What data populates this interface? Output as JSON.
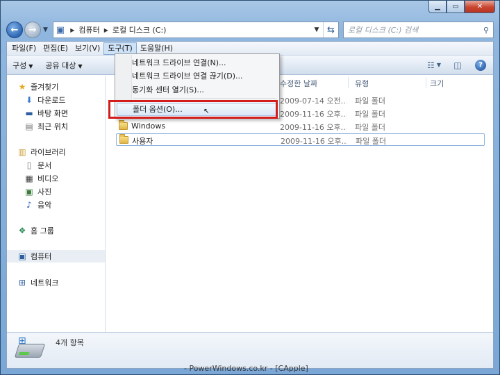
{
  "window": {
    "controls": {
      "minimize": "▁",
      "maximize": "▭",
      "close": "✕"
    }
  },
  "address_bar": {
    "crumbs": [
      "컴퓨터",
      "로컬 디스크 (C:)"
    ],
    "refresh_icon": "refresh-icon",
    "search_placeholder": "로컬 디스크 (C:) 검색"
  },
  "menubar": {
    "items": [
      "파일(F)",
      "편집(E)",
      "보기(V)",
      "도구(T)",
      "도움말(H)"
    ]
  },
  "cmdbar": {
    "organize": "구성",
    "share": "공유 대상"
  },
  "nav": {
    "favorites": "즐겨찾기",
    "downloads": "다운로드",
    "desktop": "바탕 화면",
    "recent": "최근 위치",
    "libraries": "라이브러리",
    "documents": "문서",
    "videos": "비디오",
    "pictures": "사진",
    "music": "음악",
    "homegroup": "홈 그룹",
    "computer": "컴퓨터",
    "network": "네트워크"
  },
  "columns": {
    "date": "수정한 날짜",
    "type": "유형",
    "size": "크기"
  },
  "files": [
    {
      "name": "",
      "date": "2009-07-14 오전...",
      "type": "파일 폴더"
    },
    {
      "name": "",
      "date": "2009-11-16 오후...",
      "type": "파일 폴더"
    },
    {
      "name": "Windows",
      "date": "2009-11-16 오후...",
      "type": "파일 폴더"
    },
    {
      "name": "사용자",
      "date": "2009-11-16 오후...",
      "type": "파일 폴더"
    }
  ],
  "tools_menu": {
    "items": [
      "네트워크 드라이브 연결(N)...",
      "네트워크 드라이브 연결 끊기(D)...",
      "동기화 센터 열기(S)...",
      "폴더 옵션(O)..."
    ]
  },
  "details": {
    "item_count": "4개 항목"
  },
  "watermark": "- PowerWindows.co.kr - [CApple]",
  "colors": {
    "highlight_box": "#d31c1c",
    "window_frame": "#7aa7d6"
  }
}
